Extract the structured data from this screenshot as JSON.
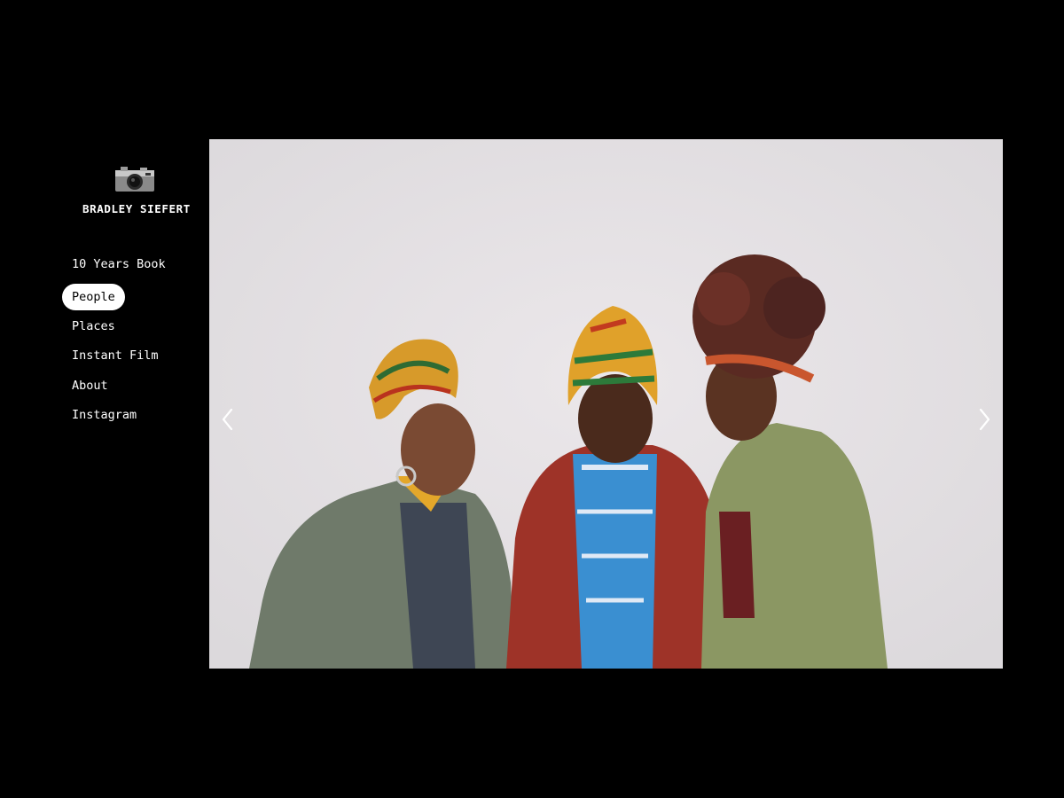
{
  "brand": {
    "name": "BRADLEY SIEFERT",
    "logo_icon": "camera-icon"
  },
  "nav": {
    "items": [
      {
        "label": "10 Years Book",
        "active": false
      },
      {
        "label": "People",
        "active": true
      },
      {
        "label": "Places",
        "active": false
      },
      {
        "label": "Instant Film",
        "active": false
      },
      {
        "label": "About",
        "active": false
      },
      {
        "label": "Instagram",
        "active": false
      }
    ]
  },
  "gallery": {
    "prev_icon": "chevron-left-icon",
    "next_icon": "chevron-right-icon"
  },
  "colors": {
    "background": "#000000",
    "text": "#ffffff",
    "active_pill": "#ffffff"
  }
}
